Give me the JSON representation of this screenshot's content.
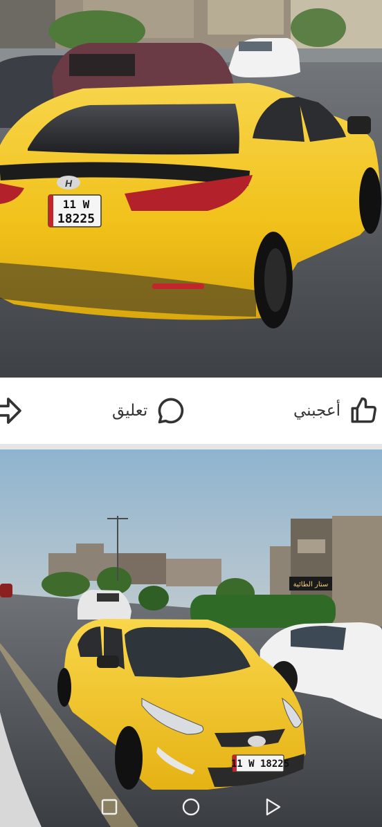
{
  "post_photo_1": {
    "plate_line1": "11  W",
    "plate_line2": "18225",
    "car_badge": "H"
  },
  "actions": {
    "like_label": "أعجبني",
    "comment_label": "تعليق",
    "like_icon": "thumbs-up-icon",
    "comment_icon": "speech-bubble-icon",
    "share_icon": "share-arrow-icon"
  },
  "post_photo_2": {
    "plate_text": "11 W 18225",
    "shop_sign": "ستار الطائية"
  },
  "navigation": {
    "recent_icon": "square-icon",
    "home_icon": "circle-icon",
    "back_icon": "triangle-back-icon"
  },
  "colors": {
    "taxi_yellow": "#f2c21b",
    "divider": "#e6e6e6",
    "icon_gray": "#333333"
  }
}
